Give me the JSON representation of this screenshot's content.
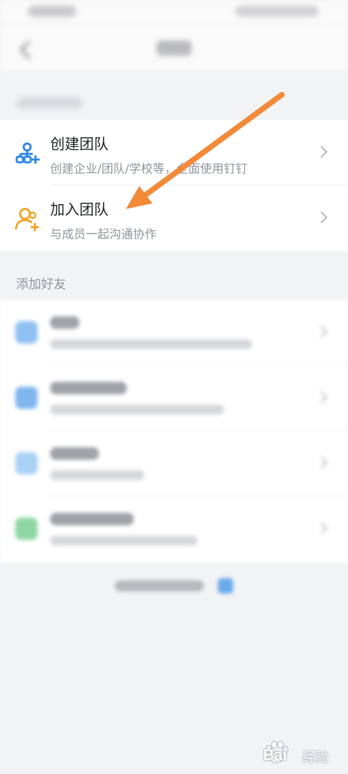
{
  "team_section": {
    "create_team": {
      "title": "创建团队",
      "subtitle": "创建企业/团队/学校等，全面使用钉钉",
      "icon": "add-organization-icon"
    },
    "join_team": {
      "title": "加入团队",
      "subtitle": "与成员一起沟通协作",
      "icon": "join-person-icon"
    }
  },
  "friends_section": {
    "caption": "添加好友"
  },
  "watermark": {
    "brand": "Bai",
    "suffix": "经验"
  },
  "annotation": {
    "arrow_color": "#f28a3a"
  },
  "colors": {
    "accent_blue": "#2f86e6",
    "accent_orange": "#f0a324"
  }
}
